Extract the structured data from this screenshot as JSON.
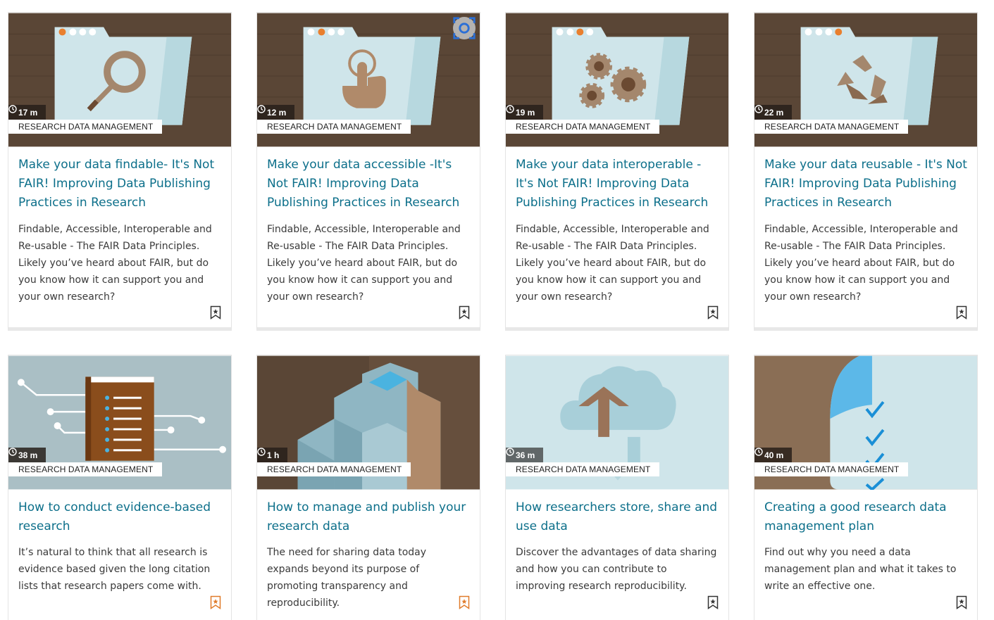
{
  "cards": [
    {
      "duration": "17 m",
      "category": "RESEARCH DATA MANAGEMENT",
      "title": "Make your data findable- It's Not FAIR! Improving Data Publishing Practices in Research",
      "description": "Findable, Accessible, Interoperable and Re-usable - The FAIR Data Principles. Likely you’ve heard about FAIR, but do you know how it can support you and your own research?",
      "bookmarked": false,
      "icon": "magnifier"
    },
    {
      "duration": "12 m",
      "category": "RESEARCH DATA MANAGEMENT",
      "title": "Make your data accessible -It's Not FAIR! Improving Data Publishing Practices in Research",
      "description": "Findable, Accessible, Interoperable and Re-usable - The FAIR Data Principles. Likely you’ve heard about FAIR, but do you know how it can support you and your own research?",
      "bookmarked": false,
      "icon": "hand-pointer"
    },
    {
      "duration": "19 m",
      "category": "RESEARCH DATA MANAGEMENT",
      "title": "Make your data interoperable - It's Not FAIR! Improving Data Publishing Practices in Research",
      "description": "Findable, Accessible, Interoperable and Re-usable - The FAIR Data Principles. Likely you’ve heard about FAIR, but do you know how it can support you and your own research?",
      "bookmarked": false,
      "icon": "gears"
    },
    {
      "duration": "22 m",
      "category": "RESEARCH DATA MANAGEMENT",
      "title": "Make your data reusable - It's Not FAIR! Improving Data Publishing Practices in Research",
      "description": "Findable, Accessible, Interoperable and Re-usable - The FAIR Data Principles. Likely you’ve heard about FAIR, but do you know how it can support you and your own research?",
      "bookmarked": false,
      "icon": "recycle"
    },
    {
      "duration": "38 m",
      "category": "RESEARCH DATA MANAGEMENT",
      "title": "How to conduct evidence-based research",
      "description": "It’s natural to think that all research is evidence based given the long citation lists that research papers come with.",
      "bookmarked": true,
      "icon": "book-circuit"
    },
    {
      "duration": "1 h",
      "category": "RESEARCH DATA MANAGEMENT",
      "title": "How to manage and publish your research data",
      "description": "The need for sharing data today expands beyond its purpose of promoting transparency and reproducibility.",
      "bookmarked": true,
      "icon": "blocks"
    },
    {
      "duration": "36 m",
      "category": "RESEARCH DATA MANAGEMENT",
      "title": "How researchers store, share and use data",
      "description": "Discover the advantages of data sharing and how you can contribute to improving research reproducibility.",
      "bookmarked": false,
      "icon": "cloud-upload"
    },
    {
      "duration": "40 m",
      "category": "RESEARCH DATA MANAGEMENT",
      "title": "Creating a good research data management plan",
      "description": "Find out why you need a data management plan and what it takes to write an effective one.",
      "bookmarked": false,
      "icon": "checklist"
    }
  ],
  "colors": {
    "title": "#0c6f8a",
    "bookmark_active": "#e07b2a",
    "bookmark_idle": "#333333",
    "brown": "#5a4636",
    "folder": "#d3e7eb"
  }
}
